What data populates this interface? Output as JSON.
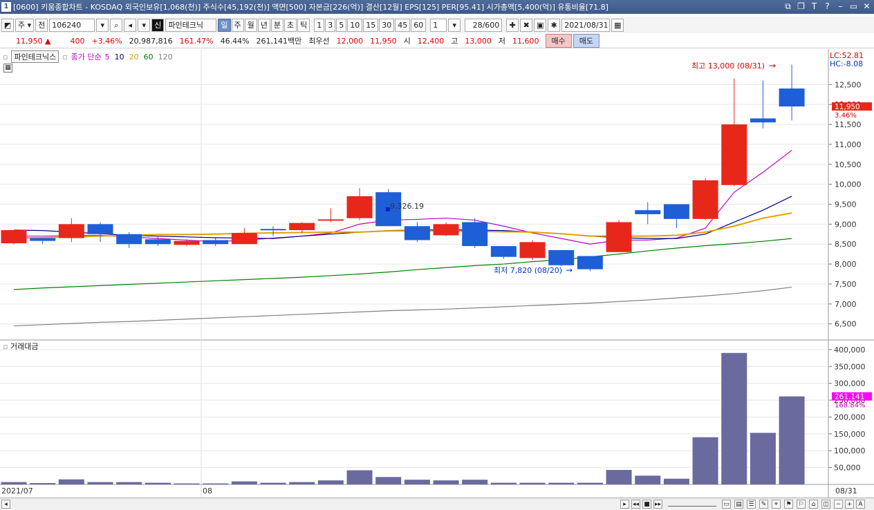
{
  "titlebar": {
    "text": "[0600] 키움종합차트 - KOSDAQ 외국인보유[1,068(천)] 주식수[45,192(천)] 액면[500] 자본금[226(억)] 결산[12월] EPS[125] PER[95.41] 시가총액[5,400(억)] 유통비율[71.8]",
    "app_number": "1"
  },
  "toolbar": {
    "market": "주",
    "whole": "전",
    "code": "106240",
    "new_label": "신",
    "stock_name": "파인테크닉",
    "periods": [
      "일",
      "주",
      "월",
      "년",
      "분",
      "초",
      "틱"
    ],
    "selected_period": "일",
    "intervals": [
      "1",
      "3",
      "5",
      "10",
      "15",
      "30",
      "45",
      "60"
    ],
    "count_value": "1",
    "range": "28",
    "range_total": "/600",
    "date": "2021/08/31"
  },
  "quote": {
    "price": "11,950",
    "change_arrow": "▲",
    "change": "400",
    "change_pct": "+3.46%",
    "volume": "20,987,816",
    "vol_ratio": "161.47%",
    "turnover": "46.44%",
    "amount": "261,141백만",
    "ask_label": "최우선",
    "ask": "12,000",
    "bid": "11,950",
    "open_label": "시",
    "open": "12,400",
    "high_label": "고",
    "high": "13,000",
    "low_label": "저",
    "low": "11,600",
    "buy": "매수",
    "sell": "매도"
  },
  "legend": {
    "name": "파인테크닉스",
    "desc": "종가 단순",
    "ma": [
      {
        "label": "5",
        "color": "#c000c0"
      },
      {
        "label": "10",
        "color": "#000080"
      },
      {
        "label": "20",
        "color": "#e0a000"
      },
      {
        "label": "60",
        "color": "#008000"
      },
      {
        "label": "120",
        "color": "#808080"
      }
    ]
  },
  "volume_legend": "거래대금",
  "price_axis": {
    "lc": "LC:52.81",
    "hc": "HC:-8.08",
    "ticks": [
      "12,500",
      "12,000",
      "11,500",
      "11,000",
      "10,500",
      "10,000",
      "9,500",
      "9,000",
      "8,500",
      "8,000",
      "7,500",
      "7,000",
      "6,500"
    ],
    "current": "11,950",
    "current_pct": "3.46%"
  },
  "volume_axis": {
    "ticks": [
      "400,000",
      "350,000",
      "300,000",
      "250,000",
      "200,000",
      "150,000",
      "100,000",
      "50,000"
    ],
    "current": "261,141",
    "current_pct": "168.84%"
  },
  "x_axis": {
    "left_label": "2021/07",
    "mid_label": "08",
    "right_label": "08/31"
  },
  "annotations": {
    "high": "최고 13,000 (08/31)",
    "low": "최저 7,820 (08/20)",
    "cursor": "9,326.19"
  },
  "chart_data": {
    "type": "candlestick",
    "y_range": [
      6200,
      13250
    ],
    "volume_range": [
      0,
      410000
    ],
    "candles": [
      {
        "o": 8520,
        "h": 8850,
        "l": 8500,
        "c": 8850,
        "v": 7000
      },
      {
        "o": 8650,
        "h": 8650,
        "l": 8500,
        "c": 8580,
        "v": 4000
      },
      {
        "o": 8650,
        "h": 9150,
        "l": 8550,
        "c": 9000,
        "v": 15000
      },
      {
        "o": 9000,
        "h": 9050,
        "l": 8550,
        "c": 8750,
        "v": 7000
      },
      {
        "o": 8750,
        "h": 8800,
        "l": 8400,
        "c": 8500,
        "v": 7000
      },
      {
        "o": 8620,
        "h": 8700,
        "l": 8450,
        "c": 8500,
        "v": 5000
      },
      {
        "o": 8480,
        "h": 8620,
        "l": 8450,
        "c": 8580,
        "v": 3000
      },
      {
        "o": 8600,
        "h": 8650,
        "l": 8450,
        "c": 8500,
        "v": 3000
      },
      {
        "o": 8500,
        "h": 8900,
        "l": 8500,
        "c": 8780,
        "v": 9000
      },
      {
        "o": 8880,
        "h": 8950,
        "l": 8700,
        "c": 8850,
        "v": 5000
      },
      {
        "o": 8850,
        "h": 9050,
        "l": 8780,
        "c": 9030,
        "v": 7000
      },
      {
        "o": 9120,
        "h": 9400,
        "l": 9050,
        "c": 9120,
        "v": 12000
      },
      {
        "o": 9150,
        "h": 9900,
        "l": 9100,
        "c": 9700,
        "v": 42000
      },
      {
        "o": 9800,
        "h": 9880,
        "l": 8950,
        "c": 8950,
        "v": 22000
      },
      {
        "o": 8950,
        "h": 9050,
        "l": 8550,
        "c": 8600,
        "v": 14000
      },
      {
        "o": 8720,
        "h": 9050,
        "l": 8700,
        "c": 9000,
        "v": 12000
      },
      {
        "o": 9050,
        "h": 9150,
        "l": 8400,
        "c": 8450,
        "v": 14000
      },
      {
        "o": 8450,
        "h": 8450,
        "l": 8130,
        "c": 8180,
        "v": 5000
      },
      {
        "o": 8150,
        "h": 8600,
        "l": 8100,
        "c": 8550,
        "v": 5000
      },
      {
        "o": 8350,
        "h": 8350,
        "l": 7950,
        "c": 7970,
        "v": 5000
      },
      {
        "o": 8200,
        "h": 8200,
        "l": 7820,
        "c": 7870,
        "v": 5000
      },
      {
        "o": 8300,
        "h": 9100,
        "l": 8300,
        "c": 9050,
        "v": 43000
      },
      {
        "o": 9350,
        "h": 9550,
        "l": 9000,
        "c": 9250,
        "v": 26000
      },
      {
        "o": 9500,
        "h": 9500,
        "l": 8900,
        "c": 9130,
        "v": 17000
      },
      {
        "o": 9130,
        "h": 10150,
        "l": 9100,
        "c": 10100,
        "v": 140000
      },
      {
        "o": 9980,
        "h": 12650,
        "l": 9950,
        "c": 11500,
        "v": 390000
      },
      {
        "o": 11650,
        "h": 12600,
        "l": 11400,
        "c": 11550,
        "v": 153000
      },
      {
        "o": 12400,
        "h": 13000,
        "l": 11600,
        "c": 11950,
        "v": 261141
      }
    ],
    "ma": {
      "5": [
        8700,
        8700,
        8710,
        8720,
        8680,
        8640,
        8600,
        8560,
        8600,
        8650,
        8700,
        8780,
        9000,
        9100,
        9120,
        9150,
        9100,
        8950,
        8780,
        8640,
        8500,
        8600,
        8600,
        8650,
        8900,
        9800,
        10300,
        10850
      ],
      "10": [
        8850,
        8840,
        8800,
        8760,
        8720,
        8700,
        8680,
        8660,
        8650,
        8640,
        8700,
        8750,
        8800,
        8840,
        8850,
        8860,
        8850,
        8840,
        8800,
        8760,
        8700,
        8660,
        8640,
        8640,
        8750,
        9050,
        9350,
        9700
      ],
      "20": [
        8650,
        8660,
        8680,
        8700,
        8720,
        8740,
        8740,
        8750,
        8770,
        8780,
        8790,
        8800,
        8800,
        8830,
        8830,
        8830,
        8820,
        8810,
        8800,
        8760,
        8700,
        8700,
        8700,
        8720,
        8800,
        8950,
        9150,
        9280
      ],
      "60": [
        7360,
        7400,
        7430,
        7460,
        7490,
        7520,
        7550,
        7580,
        7610,
        7640,
        7670,
        7710,
        7750,
        7800,
        7860,
        7910,
        7960,
        8000,
        8060,
        8110,
        8180,
        8250,
        8330,
        8400,
        8460,
        8510,
        8570,
        8640
      ],
      "120": [
        6450,
        6480,
        6510,
        6540,
        6560,
        6590,
        6620,
        6650,
        6680,
        6710,
        6740,
        6770,
        6800,
        6830,
        6850,
        6870,
        6900,
        6930,
        6960,
        6990,
        7020,
        7060,
        7100,
        7150,
        7200,
        7260,
        7330,
        7420
      ]
    },
    "colors": {
      "up": "#e8271b",
      "down": "#1e5fd8",
      "volume": "#6a6a9e"
    }
  }
}
